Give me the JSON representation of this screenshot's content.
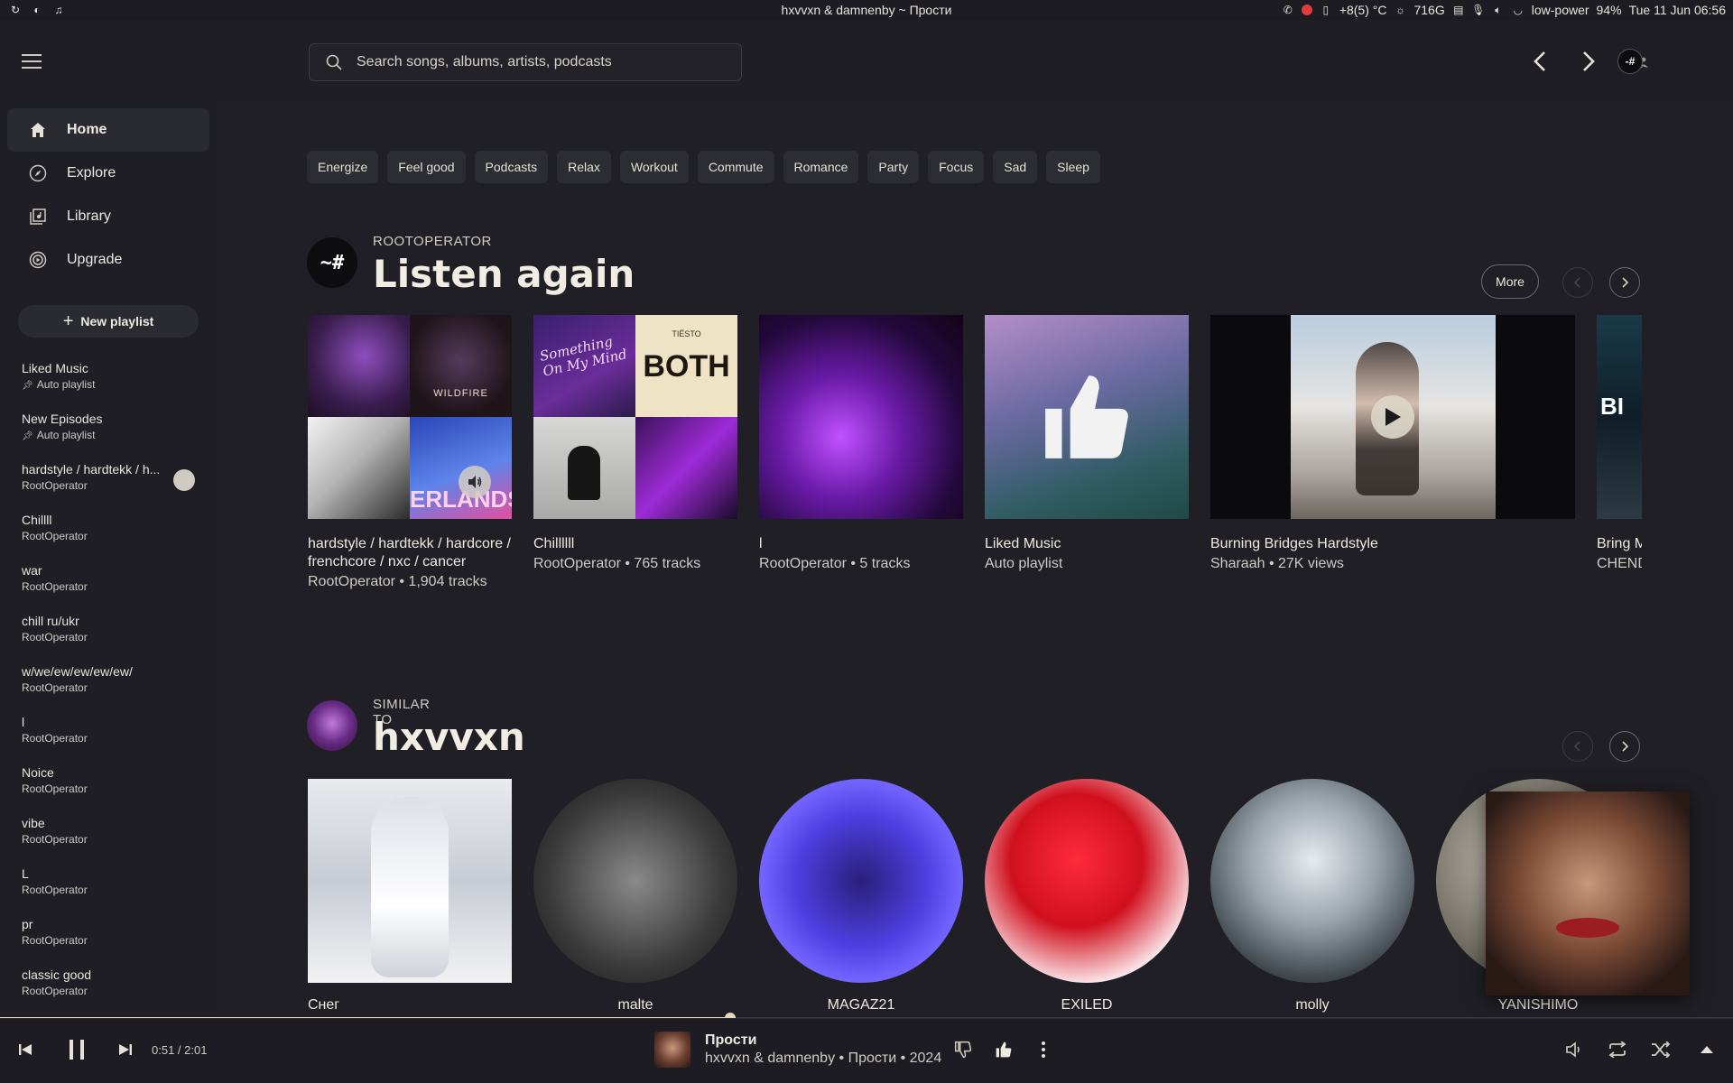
{
  "system": {
    "window_title": "hxvvxn & damnenby ~ Прости",
    "stats": "+8(5) °C",
    "disk": "716G",
    "power_mode": "low-power",
    "battery": "94%",
    "clock": "Tue 11 Jun 06:56"
  },
  "search": {
    "placeholder": "Search songs, albums, artists, podcasts"
  },
  "sidebar": {
    "nav": [
      {
        "label": "Home",
        "icon": "home-icon",
        "active": true
      },
      {
        "label": "Explore",
        "icon": "compass-icon"
      },
      {
        "label": "Library",
        "icon": "library-icon"
      },
      {
        "label": "Upgrade",
        "icon": "upgrade-icon"
      }
    ],
    "new_playlist": "New playlist",
    "playlists": [
      {
        "title": "Liked Music",
        "sub": "Auto playlist",
        "pinned": true
      },
      {
        "title": "New Episodes",
        "sub": "Auto playlist",
        "pinned": true
      },
      {
        "title": "hardstyle / hardtekk / h...",
        "sub": "RootOperator",
        "playing": true
      },
      {
        "title": "Chillll",
        "sub": "RootOperator"
      },
      {
        "title": "war",
        "sub": "RootOperator"
      },
      {
        "title": "chill ru/ukr",
        "sub": "RootOperator"
      },
      {
        "title": "w/we/ew/ew/ew/ew/",
        "sub": "RootOperator"
      },
      {
        "title": "l",
        "sub": "RootOperator"
      },
      {
        "title": "Noice",
        "sub": "RootOperator"
      },
      {
        "title": "vibe",
        "sub": "RootOperator"
      },
      {
        "title": "L",
        "sub": "RootOperator"
      },
      {
        "title": "pr",
        "sub": "RootOperator"
      },
      {
        "title": "classic good",
        "sub": "RootOperator"
      }
    ]
  },
  "chips": [
    "Energize",
    "Feel good",
    "Podcasts",
    "Relax",
    "Workout",
    "Commute",
    "Romance",
    "Party",
    "Focus",
    "Sad",
    "Sleep"
  ],
  "listen_again": {
    "kicker": "ROOTOPERATOR",
    "title": "Listen again",
    "avatar_text": "~#",
    "more": "More",
    "cards": [
      {
        "title": "hardstyle / hardtekk / hardcore / frenchcore / nxc / cancer",
        "sub": "RootOperator • 1,904 tracks"
      },
      {
        "title": "Chillllll",
        "sub": "RootOperator • 765 tracks"
      },
      {
        "title": "l",
        "sub": "RootOperator • 5 tracks"
      },
      {
        "title": "Liked Music",
        "sub": "Auto playlist"
      },
      {
        "title": "Burning Bridges Hardstyle",
        "sub": "Sharaah • 27K views"
      },
      {
        "title": "Bring M",
        "sub": "CHEND"
      }
    ],
    "art_text": {
      "wildfire": "WILDFIRE",
      "erlands": "ERLANDS",
      "tiesto": "TIËSTO",
      "both": "BOTH",
      "something": "Something On My Mind",
      "b": "BI"
    }
  },
  "similar": {
    "kicker": "SIMILAR TO",
    "title": "hxvvxn",
    "artists": [
      "Снег",
      "malte",
      "MAGAZ21",
      "EXILED",
      "molly",
      "YANISHIMO"
    ]
  },
  "player": {
    "time": "0:51 / 2:01",
    "progress": 0.4215,
    "title": "Прости",
    "subtitle": "hxvvxn & damnenby • Прости • 2024"
  },
  "colors": {
    "accent": "#e8dcb8",
    "bg": "#1f1f25",
    "sidebar": "#1e1e24"
  }
}
